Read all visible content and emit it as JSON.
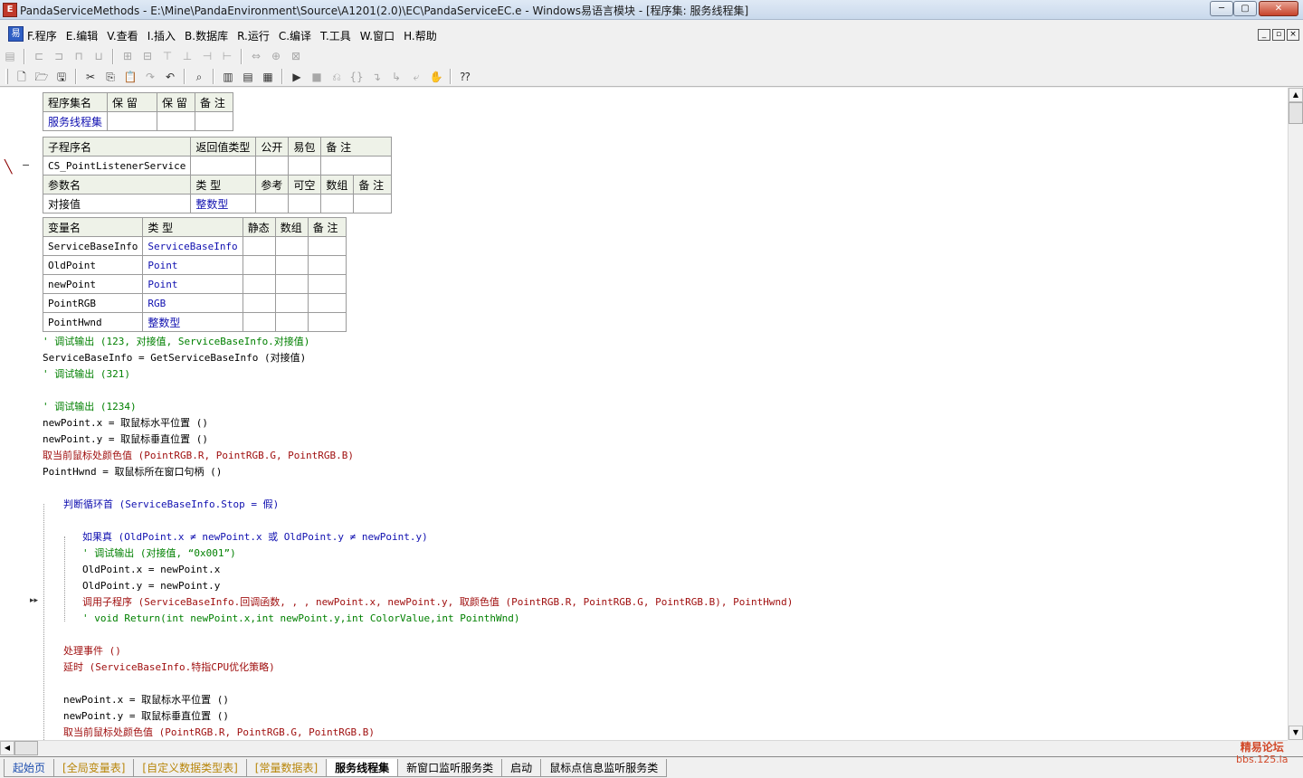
{
  "window": {
    "title": "PandaServiceMethods - E:\\Mine\\PandaEnvironment\\Source\\A1201(2.0)\\EC\\PandaServiceEC.e - Windows易语言模块 - [程序集: 服务线程集]",
    "controls": {
      "minimize": "─",
      "maximize": "▢",
      "close": "✕"
    }
  },
  "menu": {
    "items": [
      "F.程序",
      "E.编辑",
      "V.查看",
      "I.插入",
      "B.数据库",
      "R.运行",
      "C.编译",
      "T.工具",
      "W.窗口",
      "H.帮助"
    ],
    "mdi_controls": [
      "_",
      "▫",
      "×"
    ]
  },
  "toolbar1": {
    "icons": [
      "properties-icon",
      "align-left-icon",
      "align-center-icon",
      "align-right-icon",
      "distribute-icon",
      "same-width-icon",
      "same-height-icon",
      "align-top-icon",
      "align-middle-icon",
      "align-bottom-icon",
      "equal-spacing-icon",
      "center-horizontal-icon",
      "center-vertical-icon"
    ]
  },
  "toolbar2": {
    "icons": [
      "new-file-icon",
      "open-file-icon",
      "save-icon",
      "cut-icon",
      "copy-icon",
      "paste-icon",
      "redo-icon",
      "undo-icon",
      "find-icon",
      "layout1-icon",
      "layout2-icon",
      "layout3-icon",
      "run-icon",
      "stop-icon",
      "debug1-icon",
      "debug2-icon",
      "debug3-icon",
      "debug4-icon",
      "debug5-icon",
      "hand-icon",
      "help-pointer-icon"
    ]
  },
  "assembly_table": {
    "headers": [
      "程序集名",
      "保 留",
      "保 留",
      "备 注"
    ],
    "row": [
      "服务线程集",
      "",
      "",
      ""
    ]
  },
  "sub_table": {
    "headers": [
      "子程序名",
      "返回值类型",
      "公开",
      "易包",
      "备 注"
    ],
    "row": [
      "CS_PointListenerService",
      "",
      "",
      "",
      ""
    ],
    "param_headers": [
      "参数名",
      "类 型",
      "参考",
      "可空",
      "数组",
      "备 注"
    ],
    "param_row": [
      "对接值",
      "整数型",
      "",
      "",
      "",
      ""
    ]
  },
  "var_table": {
    "headers": [
      "变量名",
      "类 型",
      "静态",
      "数组",
      "备 注"
    ],
    "rows": [
      [
        "ServiceBaseInfo",
        "ServiceBaseInfo"
      ],
      [
        "OldPoint",
        "Point"
      ],
      [
        "newPoint",
        "Point"
      ],
      [
        "PointRGB",
        "RGB"
      ],
      [
        "PointHwnd",
        "整数型"
      ]
    ]
  },
  "code_lines": [
    "' 调试输出 (123, 对接值, ServiceBaseInfo.对接值)",
    "ServiceBaseInfo = GetServiceBaseInfo (对接值)",
    "' 调试输出 (321)",
    "",
    "' 调试输出 (1234)",
    "newPoint.x = 取鼠标水平位置 ()",
    "newPoint.y = 取鼠标垂直位置 ()",
    "取当前鼠标处颜色值 (PointRGB.R, PointRGB.G, PointRGB.B)",
    "PointHwnd = 取鼠标所在窗口句柄 ()",
    "",
    "判断循环首 (ServiceBaseInfo.Stop = 假)",
    "",
    "如果真 (OldPoint.x ≠ newPoint.x 或 OldPoint.y ≠ newPoint.y)",
    "' 调试输出 (对接值, “0x001”)",
    "OldPoint.x = newPoint.x",
    "OldPoint.y = newPoint.y",
    "调用子程序 (ServiceBaseInfo.回调函数, , , newPoint.x, newPoint.y, 取颜色值 (PointRGB.R, PointRGB.G, PointRGB.B), PointHwnd)",
    "' void Return(int newPoint.x,int newPoint.y,int ColorValue,int PointhWnd)",
    "",
    "处理事件 ()",
    "延时 (ServiceBaseInfo.特指CPU优化策略)",
    "",
    "newPoint.x = 取鼠标水平位置 ()",
    "newPoint.y = 取鼠标垂直位置 ()",
    "取当前鼠标处颜色值 (PointRGB.R, PointRGB.G, PointRGB.B)"
  ],
  "tabs": [
    "起始页",
    "[全局变量表]",
    "[自定义数据类型表]",
    "[常量数据表]",
    "服务线程集",
    "新窗口监听服务类",
    "启动",
    "鼠标点信息监听服务类"
  ],
  "watermark": {
    "line1": "精易论坛",
    "line2": "bbs.125.la"
  },
  "colors": {
    "keyword": "#1010b0",
    "comment": "#008000",
    "library_call": "#a01010",
    "table_header": "#eef2e8"
  }
}
